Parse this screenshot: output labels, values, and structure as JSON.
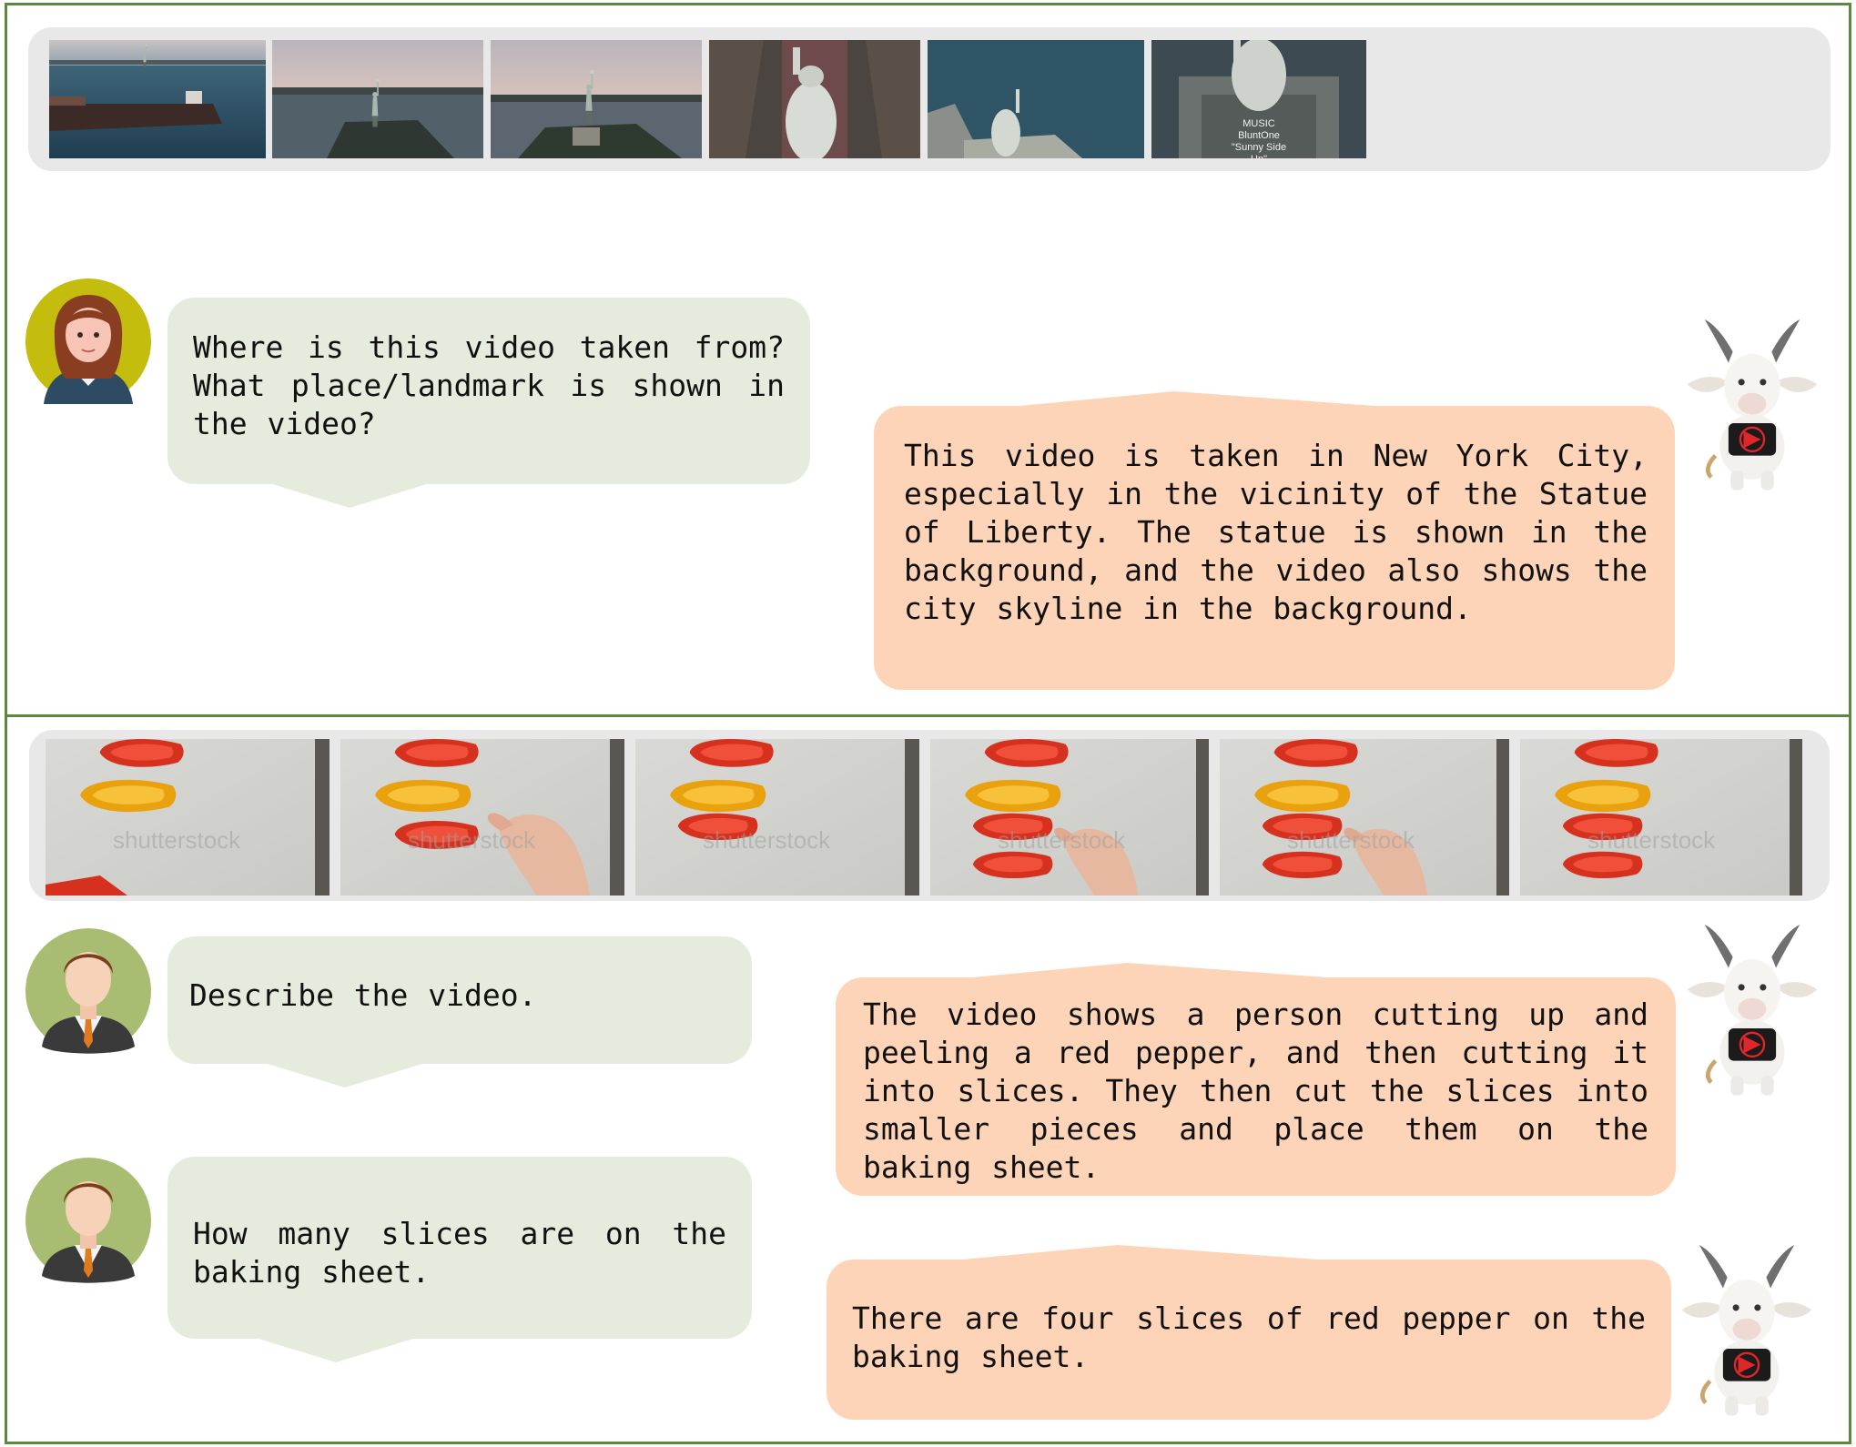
{
  "conversations": [
    {
      "frames_label": "video-frames",
      "turns": [
        {
          "role": "user",
          "text": "Where is this video taken from? What place/landmark is shown in the video?"
        },
        {
          "role": "assistant",
          "text": "This video is taken in New York City, especially in the vicinity of the Statue of Liberty. The statue is shown in the background, and the video also shows the city skyline in the background."
        }
      ],
      "music_credit": [
        "MUSIC",
        "BluntOne",
        "\"Sunny Side Up\""
      ]
    },
    {
      "frames_label": "video-frames",
      "watermark": "shutterstock",
      "turns": [
        {
          "role": "user",
          "text": "Describe the video."
        },
        {
          "role": "assistant",
          "text": "The video shows a person cutting up and peeling a red pepper, and then cutting it into slices. They then cut the slices into smaller pieces and place them on the baking sheet."
        },
        {
          "role": "user",
          "text": "How many slices are on the baking sheet."
        },
        {
          "role": "assistant",
          "text": "There are four slices of red pepper on the baking sheet."
        }
      ]
    }
  ],
  "colors": {
    "panel_border": "#5a8a3c",
    "user_bubble": "#e6ecdd",
    "assistant_bubble": "#fdd4b7",
    "filmstrip_bg": "#e8e8e8"
  }
}
